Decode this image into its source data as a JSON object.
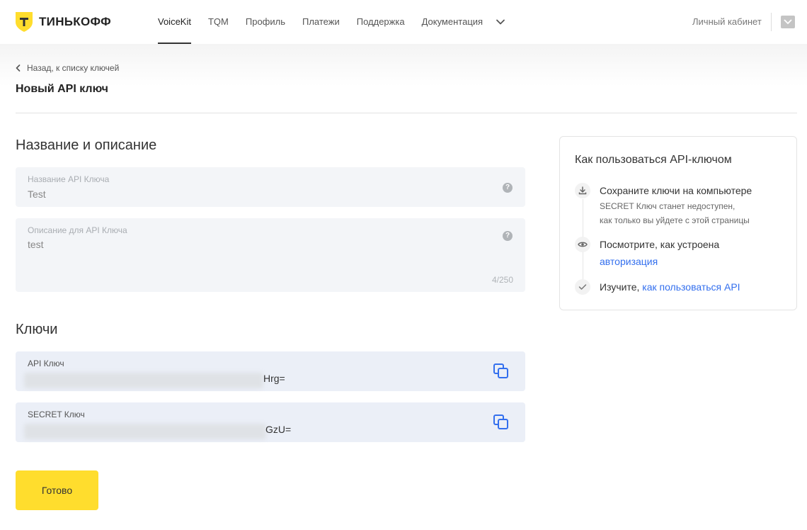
{
  "header": {
    "brand": "ТИНЬКОФФ",
    "nav": [
      {
        "label": "VoiceKit",
        "active": true
      },
      {
        "label": "TQM",
        "active": false
      },
      {
        "label": "Профиль",
        "active": false
      },
      {
        "label": "Платежи",
        "active": false
      },
      {
        "label": "Поддержка",
        "active": false
      },
      {
        "label": "Документация",
        "active": false
      }
    ],
    "cabinet": "Личный кабинет"
  },
  "breadcrumb": {
    "back": "Назад, к списку ключей"
  },
  "page_title": "Новый API ключ",
  "sections": {
    "name_desc": "Название и описание",
    "keys": "Ключи"
  },
  "fields": {
    "name": {
      "label": "Название API Ключа",
      "value": "Test"
    },
    "description": {
      "label": "Описание для API Ключа",
      "value": "test",
      "counter": "4/250"
    }
  },
  "keys": {
    "api": {
      "label": "API Ключ",
      "suffix": "Hrg="
    },
    "secret": {
      "label": "SECRET Ключ",
      "suffix": "GzU="
    }
  },
  "done_button": "Готово",
  "help_card": {
    "title": "Как пользоваться API-ключом",
    "step1": {
      "title": "Сохраните ключи на компьютере",
      "line1": "SECRET Ключ станет недоступен,",
      "line2": "как только вы уйдете с этой страницы"
    },
    "step2": {
      "title": "Посмотрите, как устроена",
      "link": "авторизация"
    },
    "step3": {
      "title": "Изучите,",
      "link": "как пользоваться API"
    }
  },
  "colors": {
    "brand_yellow": "#ffdd2d",
    "link_blue": "#336fee",
    "field_bg": "#f3f5f8",
    "key_bg": "#ebeff7"
  }
}
